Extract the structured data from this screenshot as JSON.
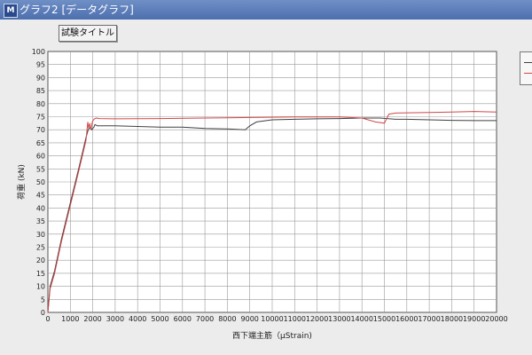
{
  "window": {
    "title": "グラフ2 [データグラフ]",
    "icon": "M"
  },
  "chart_title_button": "試験タイトル",
  "chart_data": {
    "type": "line",
    "xlabel": "西下端主筋（μStrain)",
    "ylabel": "荷重 (kN)",
    "xlim": [
      0,
      20000
    ],
    "ylim": [
      0,
      100
    ],
    "x_ticks": [
      0,
      1000,
      2000,
      3000,
      4000,
      5000,
      6000,
      7000,
      8000,
      9000,
      10000,
      11000,
      12000,
      13000,
      14000,
      15000,
      16000,
      17000,
      18000,
      19000,
      20000
    ],
    "y_ticks": [
      0,
      5,
      10,
      15,
      20,
      25,
      30,
      35,
      40,
      45,
      50,
      55,
      60,
      65,
      70,
      75,
      80,
      85,
      90,
      95,
      100
    ],
    "grid": true,
    "legend": "right",
    "series": [
      {
        "color": "#404040",
        "x": [
          0,
          100,
          300,
          600,
          1000,
          1400,
          1700,
          1800,
          1900,
          1950,
          2000,
          2050,
          2100,
          2200,
          3000,
          5000,
          6000,
          7000,
          8000,
          8800,
          9000,
          9300,
          10000,
          11000,
          12000,
          13000,
          14000,
          14800,
          15500,
          16000,
          17000,
          18000,
          19000,
          20000
        ],
        "y": [
          0,
          10,
          16,
          28,
          42,
          56,
          67,
          70,
          71,
          70,
          70.5,
          71,
          72,
          71.5,
          71.5,
          71,
          71,
          70.5,
          70.3,
          70,
          71.5,
          73,
          73.8,
          74,
          74.2,
          74.3,
          74.5,
          74.5,
          74,
          74,
          73.8,
          73.6,
          73.5,
          73.5
        ]
      },
      {
        "color": "#d04848",
        "x": [
          0,
          100,
          300,
          600,
          1000,
          1400,
          1700,
          1780,
          1820,
          1870,
          1920,
          1980,
          2050,
          2150,
          2300,
          3000,
          5000,
          7000,
          9000,
          11000,
          13000,
          14000,
          14600,
          15000,
          15200,
          15500,
          16000,
          17000,
          18000,
          19000,
          20000
        ],
        "y": [
          0,
          9,
          15,
          27,
          41,
          55,
          66,
          73,
          70.5,
          72.5,
          70,
          73,
          74,
          74.5,
          74.3,
          74.2,
          74.3,
          74.5,
          74.7,
          74.9,
          74.9,
          74.5,
          73,
          72.5,
          76,
          76.4,
          76.5,
          76.6,
          76.8,
          77,
          76.8
        ]
      }
    ]
  }
}
